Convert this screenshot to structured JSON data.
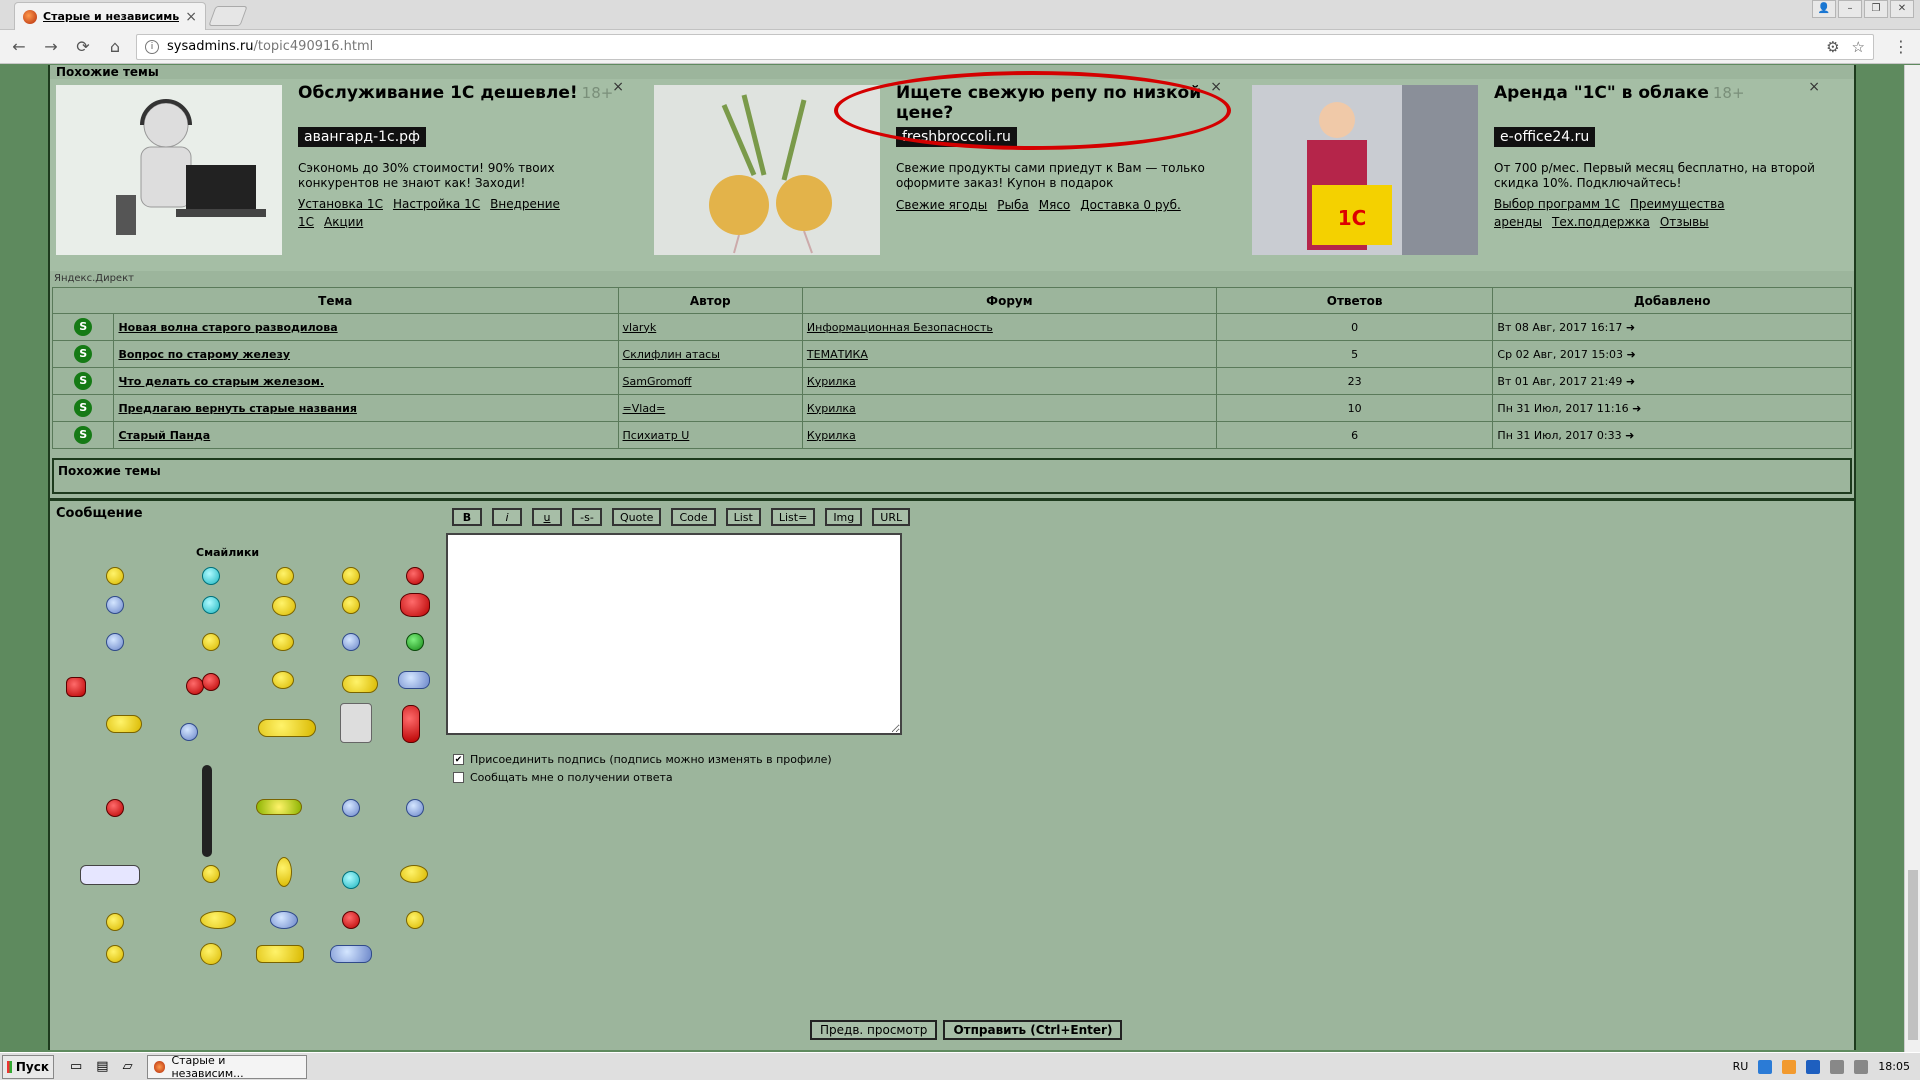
{
  "browser": {
    "tab_title": "Старые и независимые ...",
    "tab_close": "×",
    "url_host": "sysadmins.ru",
    "url_path": "/topic490916.html",
    "win_buttons": [
      "👤",
      "–",
      "❐",
      "✕"
    ]
  },
  "similar_header": "Похожие темы",
  "ads": [
    {
      "title": "Обслуживание 1С дешевле!",
      "age": "18+",
      "domain": "авангард-1с.рф",
      "desc": "Сэкономь до 30% стоимости! 90% твоих конкурентов не знают как! Заходи!",
      "links": [
        "Установка 1С",
        "Настройка 1С",
        "Внедрение 1С",
        "Акции"
      ]
    },
    {
      "title": "Ищете свежую репу по низкой цене?",
      "domain": "freshbroccoli.ru",
      "desc": "Свежие продукты сами приедут к Вам — только оформите заказ! Купон в подарок",
      "links": [
        "Свежие ягоды",
        "Рыба",
        "Мясо",
        "Доставка 0 руб."
      ]
    },
    {
      "title": "Аренда \"1С\" в облаке",
      "age": "18+",
      "domain": "e-office24.ru",
      "desc": "От 700 р/мес. Первый месяц бесплатно, на второй скидка 10%. Подключайтесь!",
      "links": [
        "Выбор программ 1С",
        "Преимущества аренды",
        "Тех.поддержка",
        "Отзывы"
      ]
    }
  ],
  "ad_close": "×",
  "yandex_direct": "Яндекс.Директ",
  "table": {
    "headers": [
      "Тема",
      "Автор",
      "Форум",
      "Ответов",
      "Добавлено"
    ],
    "rows": [
      {
        "topic": "Новая волна старого разводилова",
        "author": "vlaryk",
        "forum": "Информационная Безопасность",
        "replies": "0",
        "added": "Вт 08 Авг, 2017 16:17"
      },
      {
        "topic": "Вопрос по старому железу",
        "author": "Склифлин атасы",
        "forum": "ТЕМАТИКА",
        "replies": "5",
        "added": "Ср 02 Авг, 2017 15:03"
      },
      {
        "topic": "Что делать со старым железом.",
        "author": "SamGromoff",
        "forum": "Курилка",
        "replies": "23",
        "added": "Вт 01 Авг, 2017 21:49"
      },
      {
        "topic": "Предлагаю вернуть старые названия",
        "author": "=Vlad=",
        "forum": "Курилка",
        "replies": "10",
        "added": "Пн 31 Июл, 2017 11:16"
      },
      {
        "topic": "Старый Панда",
        "author": "Психиатр U",
        "forum": "Курилка",
        "replies": "6",
        "added": "Пн 31 Июл, 2017 0:33"
      }
    ]
  },
  "similar_footer": "Похожие темы",
  "message_label": "Сообщение",
  "toolbar": [
    "B",
    "i",
    "u",
    "-s-",
    "Quote",
    "Code",
    "List",
    "List=",
    "Img",
    "URL"
  ],
  "smilies_label": "Смайлики",
  "checkbox_signature": "Присоединить подпись (подпись можно изменять в профиле)",
  "checkbox_notify": "Сообщать мне о получении ответа",
  "preview_button": "Предв. просмотр",
  "submit_button": "Отправить (Ctrl+Enter)",
  "taskbar": {
    "start": "Пуск",
    "task_title": "Старые и независим...",
    "lang": "RU",
    "clock": "18:05"
  }
}
